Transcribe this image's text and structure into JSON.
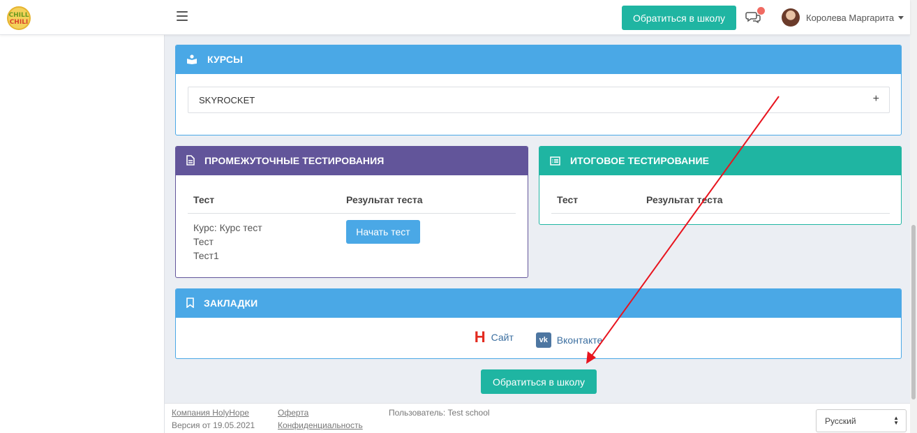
{
  "header": {
    "logo_line1": "CHILL",
    "logo_line2": "CHILI",
    "contact_button": "Обратиться в школу",
    "user_name": "Королева Маргарита"
  },
  "courses_panel": {
    "title": "Курсы",
    "items": [
      {
        "name": "SKYROCKET",
        "expand_symbol": "+"
      }
    ]
  },
  "interim_tests_panel": {
    "title": "Промежуточные тестирования",
    "columns": [
      "Тест",
      "Результат теста"
    ],
    "rows": [
      {
        "lines": [
          "Курс: Курс тест",
          "Тест",
          "Тест1"
        ],
        "action": "Начать тест"
      }
    ]
  },
  "final_test_panel": {
    "title": "Итоговое тестирование",
    "columns": [
      "Тест",
      "Результат теста"
    ]
  },
  "bookmarks_panel": {
    "title": "Закладки",
    "links": [
      {
        "label": "Сайт",
        "icon": "holyhope-icon",
        "glyph": "H"
      },
      {
        "label": "Вконтакте",
        "icon": "vk-icon",
        "glyph": "vk"
      }
    ]
  },
  "contact_button_bottom": "Обратиться в школу",
  "footer": {
    "company": "Компания HolyHope",
    "version": "Версия от 19.05.2021",
    "offer": "Оферта",
    "privacy": "Конфиденциальность",
    "user": "Пользователь: Test school",
    "language": "Русский"
  },
  "colors": {
    "blue": "#4aa8e6",
    "purple": "#62559a",
    "teal": "#1fb5a2",
    "annotation_arrow": "#e8141e"
  }
}
